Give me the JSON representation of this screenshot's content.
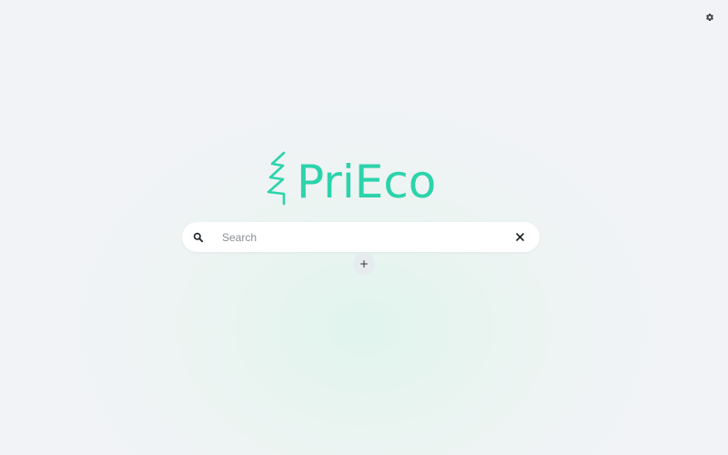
{
  "brand": {
    "name": "PriEco",
    "color": "#2cd3ab"
  },
  "search": {
    "placeholder": "Search",
    "value": ""
  },
  "actions": {
    "add_label": "+"
  },
  "icons": {
    "settings": "gear-icon",
    "search": "search-icon",
    "clear": "close-icon",
    "logo": "tree-icon"
  }
}
